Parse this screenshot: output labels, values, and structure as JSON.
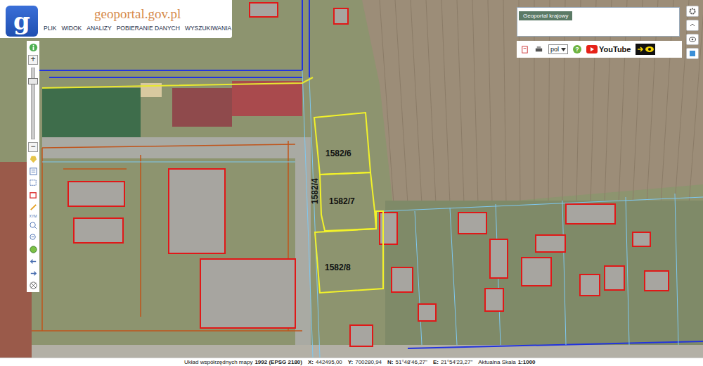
{
  "logo": {
    "letter": "g",
    "text": "geoportal.gov.pl"
  },
  "menu": [
    "PLIK",
    "WIDOK",
    "ANALIZY",
    "POBIERANIE DANYCH",
    "WYSZUKIWANIA"
  ],
  "overview": {
    "title": "Geoportal krajowy"
  },
  "language": {
    "value": "pol"
  },
  "help": "?",
  "youtube": "YouTube",
  "zoom": {
    "in": "+",
    "out": "−",
    "level": 0.85
  },
  "tools": [
    "XYM"
  ],
  "parcels": [
    {
      "label": "1582/6"
    },
    {
      "label": "1582/7"
    },
    {
      "label": "1582/8"
    },
    {
      "label": "1582/4"
    }
  ],
  "status_bar": {
    "crs_label": "Układ współrzędnych mapy",
    "crs": "1992 (EPSG 2180)",
    "x_label": "X:",
    "x": "442495,00",
    "y_label": "Y:",
    "y": "700280,94",
    "n_label": "N:",
    "n": "51°48'46,27\"",
    "e_label": "E:",
    "e": "21°54'23,27\"",
    "scale_label": "Aktualna Skala",
    "scale": "1:1000"
  }
}
